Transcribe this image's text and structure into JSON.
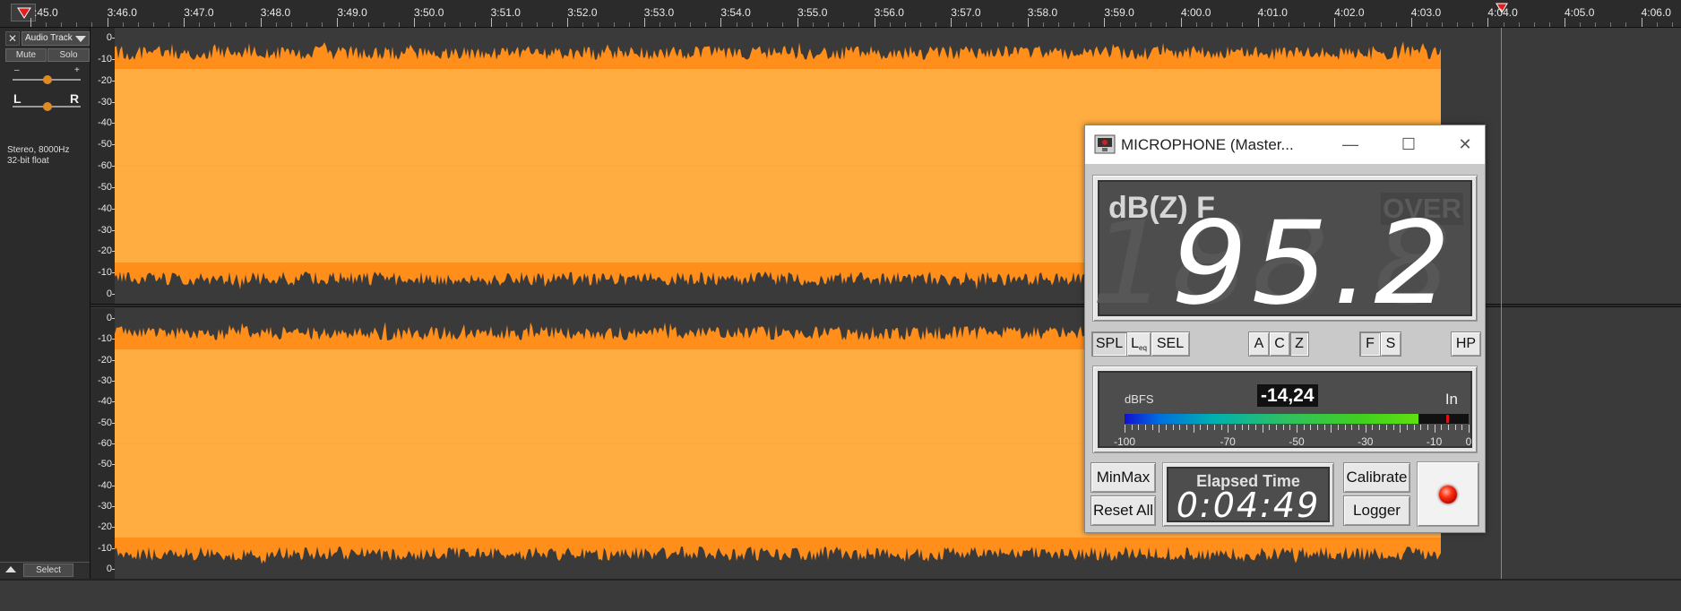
{
  "timeline": {
    "labels": [
      ":45.0",
      "3:46.0",
      "3:47.0",
      "3:48.0",
      "3:49.0",
      "3:50.0",
      "3:51.0",
      "3:52.0",
      "3:53.0",
      "3:54.0",
      "3:55.0",
      "3:56.0",
      "3:57.0",
      "3:58.0",
      "3:59.0",
      "4:00.0",
      "4:01.0",
      "4:02.0",
      "4:03.0",
      "4:04.0",
      "4:05.0",
      "4:06.0"
    ]
  },
  "track": {
    "close_glyph": "✕",
    "name": "Audio Track",
    "mute_label": "Mute",
    "solo_label": "Solo",
    "gain_minus": "–",
    "gain_plus": "+",
    "pan_left": "L",
    "pan_right": "R",
    "info_line1": "Stereo, 8000Hz",
    "info_line2": "32-bit float",
    "select_label": "Select"
  },
  "db_scale": [
    "0",
    "-10",
    "-20",
    "-30",
    "-40",
    "-50",
    "-60",
    "-50",
    "-40",
    "-30",
    "-20",
    "-10",
    "0"
  ],
  "slm": {
    "title": "MICROPHONE (Master...",
    "minimize_glyph": "—",
    "maximize_glyph": "☐",
    "close_glyph": "✕",
    "weighting": "dB(Z) F",
    "over": "OVER",
    "value": "95.2",
    "ghost": "188.8",
    "buttons": {
      "spl": "SPL",
      "leq_main": "L",
      "leq_sub": "eq",
      "sel": "SEL",
      "a": "A",
      "c": "C",
      "z": "Z",
      "f": "F",
      "s": "S",
      "hp": "HP"
    },
    "meter": {
      "unit": "dBFS",
      "value": "-14,24",
      "input": "In",
      "level_fraction": 0.855,
      "peak_fraction": 0.935,
      "scale_labels": [
        "-100",
        "-70",
        "-50",
        "-30",
        "-10",
        "0"
      ]
    },
    "minmax": "MinMax",
    "reset_all": "Reset All",
    "elapsed_title": "Elapsed Time",
    "elapsed_value": "0:04:49",
    "calibrate": "Calibrate",
    "logger": "Logger"
  },
  "colors": {
    "waveform": "#FFAC40",
    "waveform_rms": "#FF8E1A",
    "background": "#3A3A3A"
  }
}
